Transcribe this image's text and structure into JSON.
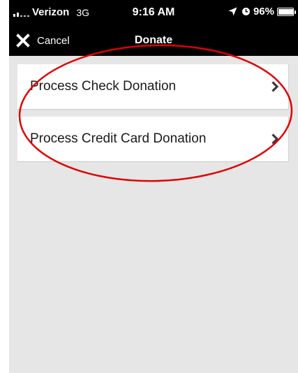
{
  "status_bar": {
    "carrier": "Verizon",
    "network": "3G",
    "time": "9:16 AM",
    "battery": "96%"
  },
  "nav": {
    "cancel_label": "Cancel",
    "title": "Donate"
  },
  "menu": {
    "items": [
      {
        "label": "Process Check Donation"
      },
      {
        "label": "Process Credit Card Donation"
      }
    ]
  },
  "colors": {
    "bar_background": "#000000",
    "content_background": "#e6e6e6",
    "annotation": "#e00000"
  }
}
